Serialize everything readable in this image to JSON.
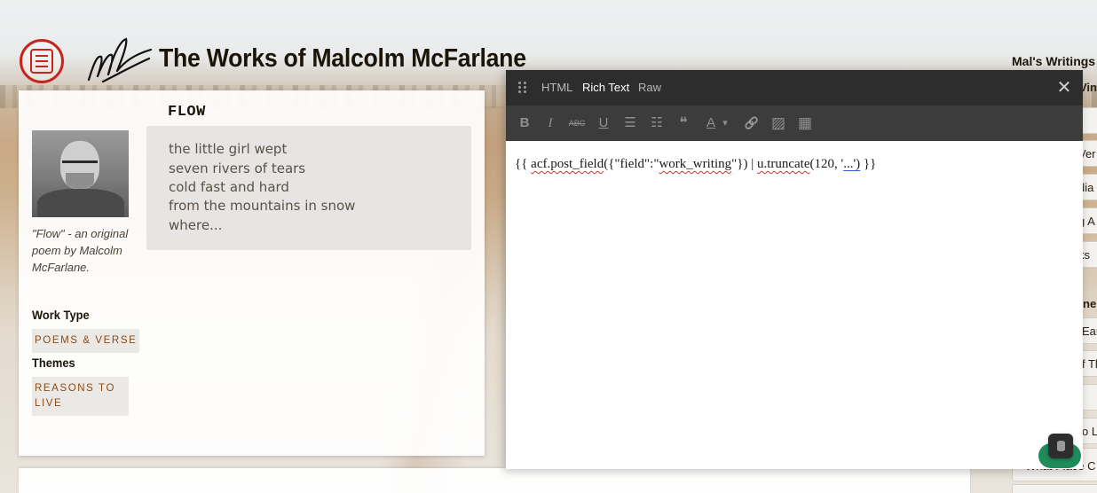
{
  "site": {
    "title": "The Works of Malcolm McFarlane",
    "sidebar_heading": "Mal's Writings &",
    "colors": {
      "logo_red": "#c8241c",
      "tag_text": "#8a4b16",
      "editor_dark": "#2d2d2d"
    }
  },
  "sidebar_fragments": [
    "Vini",
    "Ver",
    "dia",
    "g A",
    "ks",
    "ne",
    "Ear",
    "f Th",
    "o L"
  ],
  "sidebar_bottom_item": "What Place C",
  "work": {
    "title": "FLOW",
    "poem_lines": [
      "the little girl wept",
      "seven rivers of tears",
      "cold fast and hard",
      "from the mountains in snow",
      "where..."
    ],
    "caption_lines": [
      "\"Flow\" - an original",
      "poem  by Malcolm",
      "McFarlane."
    ],
    "work_type_label": "Work Type",
    "work_type_tag": "POEMS & VERSE",
    "themes_label": "Themes",
    "themes_tag_lines": [
      "REASONS TO",
      "LIVE"
    ]
  },
  "editor": {
    "tabs": [
      {
        "label": "HTML",
        "active": false
      },
      {
        "label": "Rich Text",
        "active": true
      },
      {
        "label": "Raw",
        "active": false
      }
    ],
    "toolbar": [
      {
        "icon": "bold-icon",
        "glyph": "B"
      },
      {
        "icon": "italic-icon",
        "glyph": "I"
      },
      {
        "icon": "strikethrough-icon",
        "glyph": "ABC"
      },
      {
        "icon": "underline-icon",
        "glyph": "U"
      },
      {
        "icon": "bullet-list-icon",
        "glyph": "☰"
      },
      {
        "icon": "numbered-list-icon",
        "glyph": "☷"
      },
      {
        "icon": "quote-icon",
        "glyph": "❝"
      },
      {
        "icon": "font-color-icon",
        "glyph": "A"
      },
      {
        "icon": "dropdown-caret-icon",
        "glyph": "▾"
      },
      {
        "icon": "link-icon",
        "glyph": "🔗"
      },
      {
        "icon": "image-icon",
        "glyph": "▨"
      },
      {
        "icon": "table-icon",
        "glyph": "▦"
      }
    ],
    "content_parts": [
      "{{ ",
      "acf.post_field",
      "({\"field\":\"",
      "work_writing",
      "\"}) | ",
      "u.truncate",
      "(120, '",
      "...')",
      " }}"
    ]
  }
}
